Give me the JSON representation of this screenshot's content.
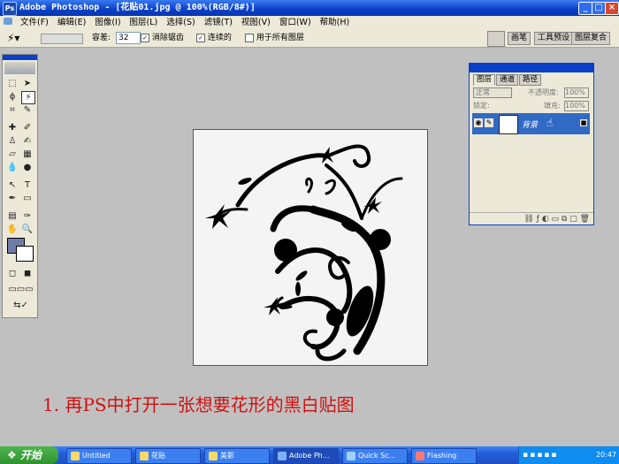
{
  "window": {
    "title": "Adobe Photoshop - [花贴01.jpg @ 100%(RGB/8#)]",
    "buttons": [
      "minimize",
      "maximize",
      "close"
    ]
  },
  "menu": {
    "items": [
      "文件(F)",
      "编辑(E)",
      "图像(I)",
      "图层(L)",
      "选择(S)",
      "滤镜(T)",
      "视图(V)",
      "窗口(W)",
      "帮助(H)"
    ]
  },
  "options": {
    "tolerance_label": "容差:",
    "tolerance_value": "32",
    "anti_alias_label": "消除锯齿",
    "contiguous_label": "连续的",
    "all_layers_label": "用于所有图层",
    "palette_tabs": [
      "画笔",
      "工具预设",
      "图层复合"
    ]
  },
  "layers_panel": {
    "tabs": [
      "图层",
      "通道",
      "路径"
    ],
    "blend_mode": "正常",
    "opacity_label": "不透明度:",
    "opacity_value": "100%",
    "lock_label": "锁定:",
    "fill_label": "填充:",
    "fill_value": "100%",
    "layer_name": "背景"
  },
  "caption": "1. 再PS中打开一张想要花形的黑白贴图",
  "taskbar": {
    "start_label": "开始",
    "tasks": [
      "Untitled",
      "花贴",
      "美影",
      "Adobe Ph...",
      "Quick Sc...",
      "Flashing"
    ],
    "clock": "20:47"
  }
}
